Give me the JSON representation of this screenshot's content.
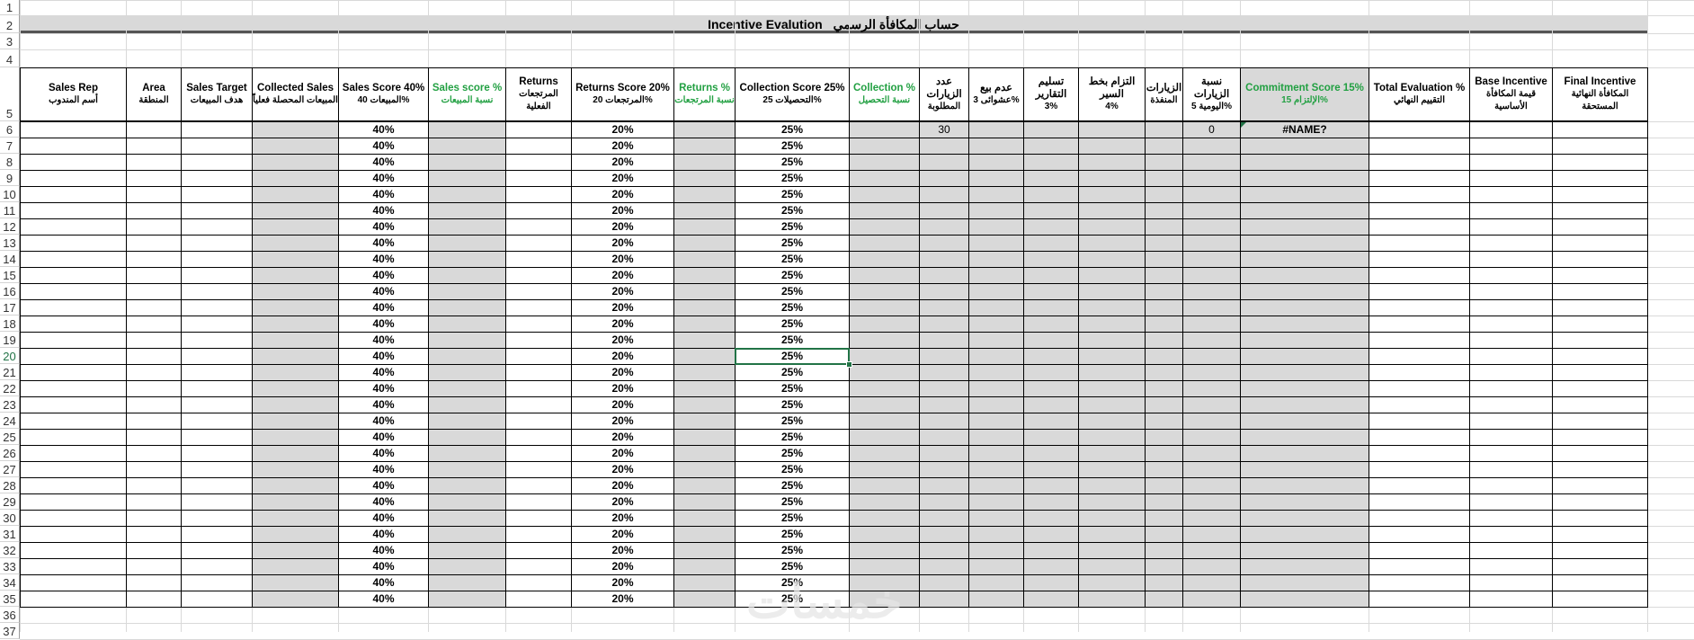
{
  "sheet_title": {
    "en": "Incentive Evalution",
    "ar": "حساب المكافأة الرسمي"
  },
  "row_numbers": [
    "1",
    "2",
    "3",
    "4",
    "5",
    "6",
    "7",
    "8",
    "9",
    "10",
    "11",
    "12",
    "13",
    "14",
    "15",
    "16",
    "17",
    "18",
    "19",
    "20",
    "21",
    "22",
    "23",
    "24",
    "25",
    "26",
    "27",
    "28",
    "29",
    "30",
    "31",
    "32",
    "33",
    "34",
    "35",
    "36",
    "37"
  ],
  "selected_row": "20",
  "headers": [
    {
      "en": "Sales Rep",
      "ar": "أسم المندوب"
    },
    {
      "en": "Area",
      "ar": "المنطقة"
    },
    {
      "en": "Sales Target",
      "ar": "هدف المبيعات"
    },
    {
      "en": "Collected Sales",
      "ar": "المبيعات المحصلة فعلياً"
    },
    {
      "en": "Sales Score 40%",
      "ar": "المبيعات 40%"
    },
    {
      "en": "Sales score %",
      "ar": "نسبة المبيعات"
    },
    {
      "en": "Returns",
      "ar": "المرتجعات الفعلية"
    },
    {
      "en": "Returns Score 20%",
      "ar": "المرتجعات 20%"
    },
    {
      "en": "Returns %",
      "ar": "نسبة المرتجعات"
    },
    {
      "en": "Collection Score 25%",
      "ar": "التحصيلات 25%"
    },
    {
      "en": "Collection %",
      "ar": "نسبة التحصيل"
    },
    {
      "en": "عدد الزيارات",
      "ar": "المطلوبة"
    },
    {
      "en": "عدم بيع",
      "ar": "عشوائى 3%"
    },
    {
      "en": "تسليم التقارير",
      "ar": "3%"
    },
    {
      "en": "التزام بخط السير",
      "ar": "4%"
    },
    {
      "en": "الزيارات",
      "ar": "المنفذة"
    },
    {
      "en": "نسبة الزيارات",
      "ar": "اليومية 5%"
    },
    {
      "en": "Commitment Score 15%",
      "ar": "الإلتزام 15%"
    },
    {
      "en": "Total Evaluation %",
      "ar": "التقييم النهائي"
    },
    {
      "en": "Base Incentive",
      "ar": "قيمة المكافأة الأساسية"
    },
    {
      "en": "Final Incentive",
      "ar": "المكافأة النهائية المستحقة"
    }
  ],
  "column_defaults": {
    "sales_score": "40%",
    "returns_score": "20%",
    "collection_score": "25%"
  },
  "row6_extras": {
    "required_visits": "30",
    "daily_visits_pct": "0",
    "commitment_score": "#NAME?"
  },
  "watermark": "خمسات",
  "colors": {
    "header_green": "#22a042",
    "gray_fill": "#d9d9d9",
    "selection": "#217346"
  }
}
